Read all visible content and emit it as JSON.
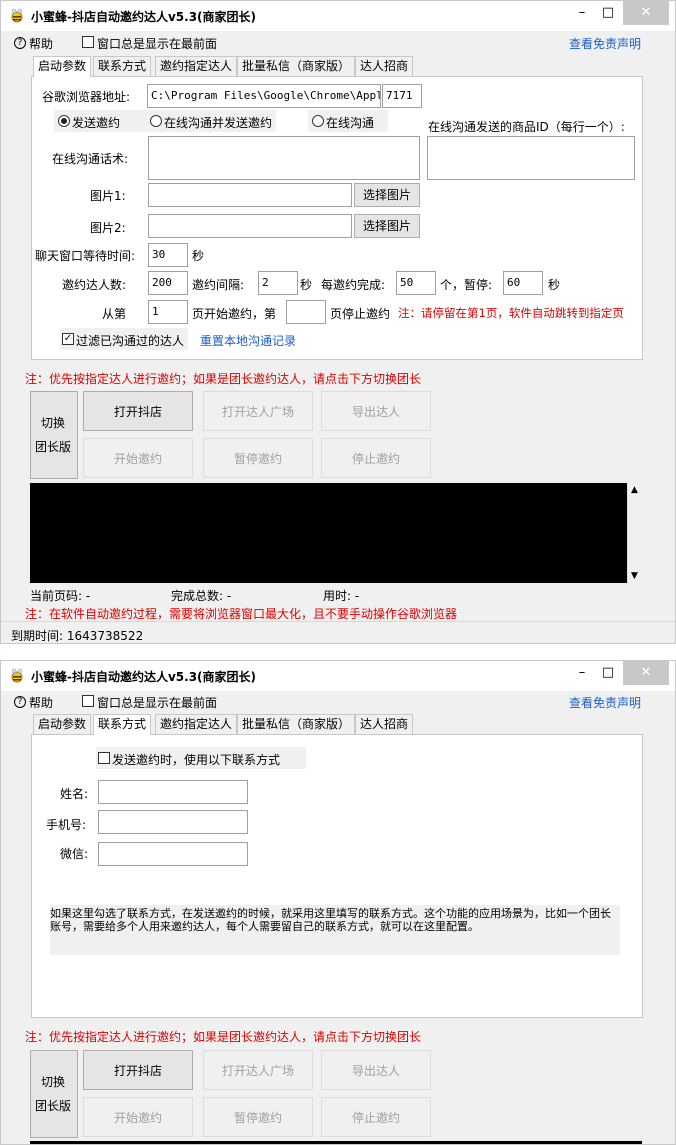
{
  "app": {
    "title": "小蜜蜂-抖店自动邀约达人v5.3(商家团长)",
    "minimize": "–",
    "maximize": "□",
    "close": "✕"
  },
  "menu": {
    "help": "帮助",
    "always_on_top": "窗口总是显示在最前面",
    "disclaimer": "查看免责声明"
  },
  "tabs": [
    "启动参数",
    "联系方式",
    "邀约指定达人",
    "批量私信（商家版）",
    "达人招商"
  ],
  "startup": {
    "browser_label": "谷歌浏览器地址:",
    "browser_path": "C:\\Program Files\\Google\\Chrome\\Applica",
    "port": "7171",
    "radio_send": "发送邀约",
    "radio_chat_send": "在线沟通并发送邀约",
    "radio_chat": "在线沟通",
    "product_id_label": "在线沟通发送的商品ID（每行一个）:",
    "script_label": "在线沟通话术:",
    "image1_label": "图片1:",
    "image2_label": "图片2:",
    "choose_image": "选择图片",
    "wait_label": "聊天窗口等待时间:",
    "wait_value": "30",
    "sec": "秒",
    "count_label": "邀约达人数:",
    "count_value": "200",
    "interval_label": "邀约间隔:",
    "interval_value": "2",
    "per_label": "每邀约完成:",
    "per_value": "50",
    "pause_label": "个，暂停:",
    "pause_value": "60",
    "from_label": "从第",
    "from_value": "1",
    "page_start_label": "页开始邀约，第",
    "page_end_label": "页停止邀约",
    "page_note": "注：请停留在第1页，软件自动跳转到指定页",
    "filter_label": "过滤已沟通过的达人",
    "reset_link": "重置本地沟通记录"
  },
  "note_top": "注：优先按指定达人进行邀约；如果是团长邀约达人，请点击下方切换团长",
  "buttons": {
    "switch": "切换\n团长版",
    "switch_l1": "切换",
    "switch_l2": "团长版",
    "open_store": "打开抖店",
    "open_square": "打开达人广场",
    "export": "导出达人",
    "start": "开始邀约",
    "pause": "暂停邀约",
    "stop": "停止邀约"
  },
  "status": {
    "page_label": "当前页码: -",
    "total_label": "完成总数: -",
    "time_label": "用时: -"
  },
  "note_bottom": "注：在软件自动邀约过程，需要将浏览器窗口最大化，且不要手动操作谷歌浏览器",
  "expire": "到期时间: 1643738522",
  "contact": {
    "use_contact": "发送邀约时，使用以下联系方式",
    "name_label": "姓名:",
    "phone_label": "手机号:",
    "wechat_label": "微信:",
    "description": "如果这里勾选了联系方式，在发送邀约的时候，就采用这里填写的联系方式。这个功能的应用场景为，比如一个团长账号，需要给多个人用来邀约达人，每个人需要留自己的联系方式，就可以在这里配置。"
  },
  "colors": {
    "link": "#1a5fcc",
    "note": "#e00000",
    "log_bg": "#000000"
  }
}
